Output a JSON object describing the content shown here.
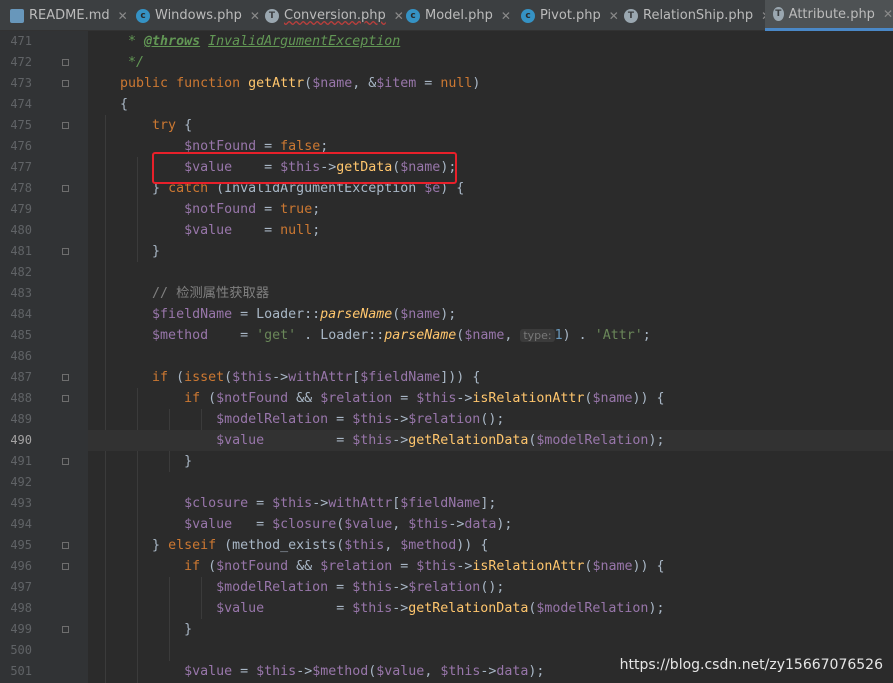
{
  "tabs": [
    {
      "name": "README.md",
      "icon": "markdown-file-icon"
    },
    {
      "name": "Windows.php",
      "icon": "class-file-icon"
    },
    {
      "name": "Conversion.php",
      "icon": "trait-file-icon"
    },
    {
      "name": "Model.php",
      "icon": "class-file-icon"
    },
    {
      "name": "Pivot.php",
      "icon": "class-file-icon"
    },
    {
      "name": "RelationShip.php",
      "icon": "trait-file-icon"
    },
    {
      "name": "Attribute.php",
      "icon": "trait-file-icon"
    }
  ],
  "close_glyph": "✕",
  "line_numbers": [
    "471",
    "472",
    "473",
    "474",
    "475",
    "476",
    "477",
    "478",
    "479",
    "480",
    "481",
    "482",
    "483",
    "484",
    "485",
    "486",
    "487",
    "488",
    "489",
    "490",
    "491",
    "492",
    "493",
    "494",
    "495",
    "496",
    "497",
    "498",
    "499",
    "500",
    "501"
  ],
  "current_line": "490",
  "watermark": "https://blog.csdn.net/zy15667076526",
  "inlay_hint": "type:",
  "comment_text": "// 检测属性获取器"
}
